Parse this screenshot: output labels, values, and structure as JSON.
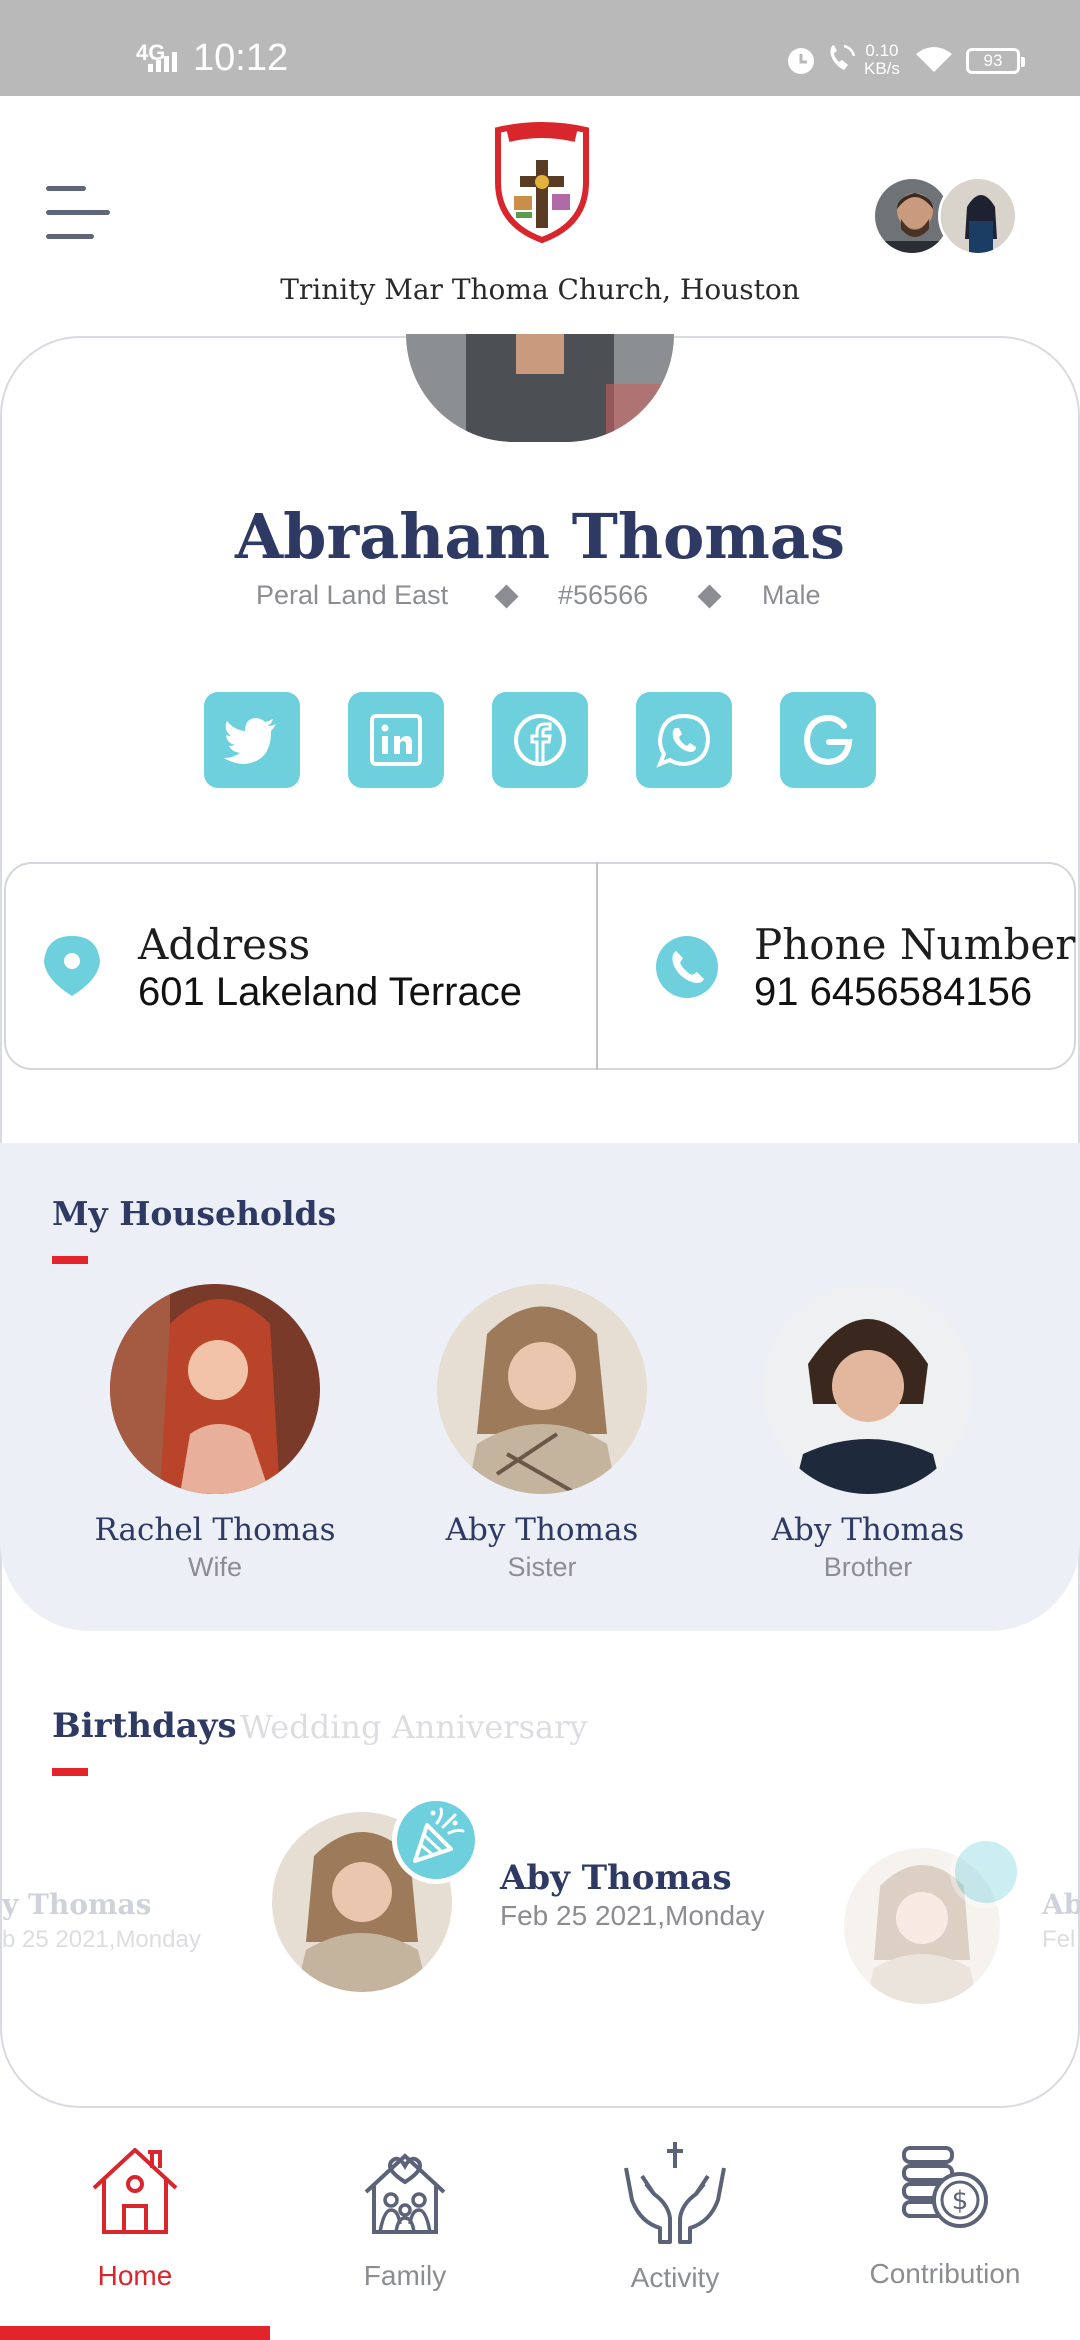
{
  "status_bar": {
    "network": "4G",
    "time": "10:12",
    "speed_value": "0.10",
    "speed_unit": "KB/s",
    "battery": "93"
  },
  "header": {
    "church_name": "Trinity Mar Thoma Church, Houston",
    "logo_icon": "church-crest-logo"
  },
  "profile": {
    "name": "Abraham Thomas",
    "area": "Peral Land East",
    "member_id": "#56566",
    "gender": "Male"
  },
  "social": {
    "color": "#6dd0dc",
    "items": [
      "twitter-icon",
      "linkedin-icon",
      "facebook-icon",
      "whatsapp-icon",
      "google-icon"
    ]
  },
  "contact": {
    "address_label": "Address",
    "address_value": "601 Lakeland Terrace",
    "phone_label": "Phone Number",
    "phone_value": "91 6456584156"
  },
  "households": {
    "title": "My Households",
    "members": [
      {
        "name": "Rachel Thomas",
        "relation": "Wife"
      },
      {
        "name": "Aby Thomas",
        "relation": "Sister"
      },
      {
        "name": "Aby Thomas",
        "relation": "Brother"
      }
    ]
  },
  "events": {
    "tabs": {
      "active": "Birthdays",
      "inactive": "Wedding Anniversary"
    },
    "left_name": "y Thomas",
    "left_date": "b 25 2021,Monday",
    "center_name": "Aby Thomas",
    "center_date": "Feb 25 2021,Monday",
    "right_name": "Ab",
    "right_date": "Fel"
  },
  "nav": {
    "active_color": "#d8262c",
    "items": [
      {
        "label": "Home",
        "icon": "home-icon"
      },
      {
        "label": "Family",
        "icon": "family-icon"
      },
      {
        "label": "Activity",
        "icon": "prayer-hands-icon"
      },
      {
        "label": "Contribution",
        "icon": "coins-icon"
      }
    ]
  }
}
